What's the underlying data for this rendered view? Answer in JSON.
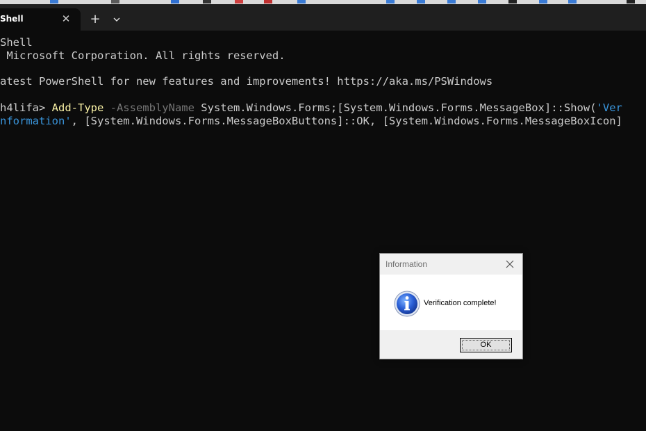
{
  "window": {
    "tab_label": "Shell",
    "new_tab_glyph": "+",
    "close_glyph": "✕"
  },
  "terminal": {
    "lines": [
      "Shell",
      " Microsoft Corporation. All rights reserved.",
      "",
      "atest PowerShell for new features and improvements! https://aka.ms/PSWindows"
    ],
    "prompt": "h4lifa> ",
    "cmd_name": "Add-Type",
    "cmd_param": " -AssemblyName",
    "cmd_rest": " System.Windows.Forms;[System.Windows.Forms.MessageBox]::Show(",
    "cmd_str1": "'Ver",
    "line2_str": "nformation'",
    "line2_rest": ", [System.Windows.Forms.MessageBoxButtons]::OK, [System.Windows.Forms.MessageBoxIcon]"
  },
  "messagebox": {
    "title": "Information",
    "message": "Verification complete!",
    "ok_label": "OK"
  },
  "icons": {
    "tab_close": "close-icon",
    "new_tab": "plus-icon",
    "dropdown": "chevron-down-icon",
    "dialog_close": "close-icon",
    "dialog_info": "info-icon"
  },
  "colors": {
    "terminal_bg": "#0c0c0c",
    "titlebar_bg": "#1f1f1f",
    "text": "#cccccc",
    "cmdlet": "#f9f1a5",
    "param": "#767676",
    "string": "#3a96dd"
  }
}
